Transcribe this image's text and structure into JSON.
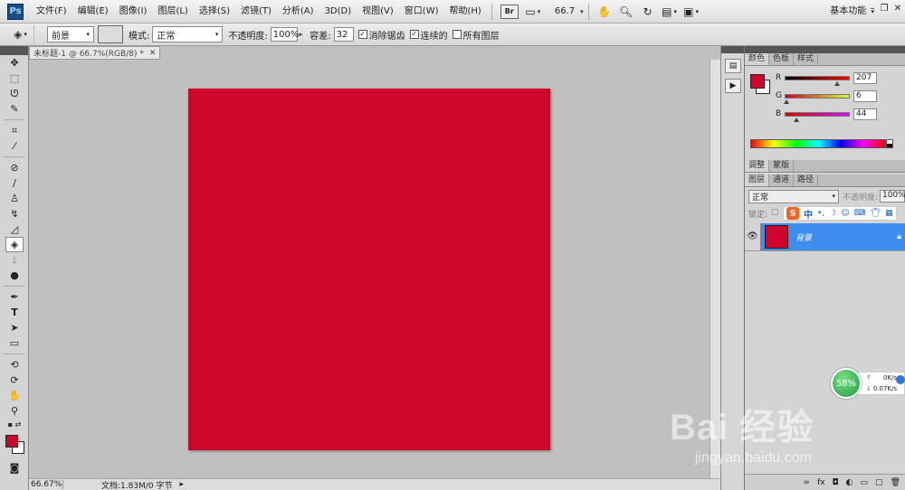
{
  "menubar": {
    "logo": "Ps",
    "items": [
      "文件(F)",
      "编辑(E)",
      "图像(I)",
      "图层(L)",
      "选择(S)",
      "滤镜(T)",
      "分析(A)",
      "3D(D)",
      "视图(V)",
      "窗口(W)",
      "帮助(H)"
    ],
    "bridge_label": "Br",
    "zoom_value": "66.7",
    "workspace": "基本功能"
  },
  "options_bar": {
    "fill_source": "前景",
    "mode_label": "模式:",
    "mode_value": "正常",
    "opacity_label": "不透明度:",
    "opacity_value": "100%",
    "tolerance_label": "容差:",
    "tolerance_value": "32",
    "antialias_label": "消除锯齿",
    "contiguous_label": "连续的",
    "all_layers_label": "所有图层"
  },
  "document": {
    "tab_title": "未标题-1 @ 66.7%(RGB/8) *",
    "canvas_color": "#cf062c",
    "status_zoom": "66.67%",
    "status_doc": "文档:1.83M/0 字节"
  },
  "color_panel": {
    "tabs": [
      "颜色",
      "色板",
      "样式"
    ],
    "r_label": "R",
    "r_value": "207",
    "g_label": "G",
    "g_value": "6",
    "b_label": "B",
    "b_value": "44",
    "r_fraction": 0.81,
    "g_fraction": 0.02,
    "b_fraction": 0.17
  },
  "adjust_panel": {
    "tabs": [
      "调整",
      "蒙版"
    ]
  },
  "layers_panel": {
    "tabs": [
      "图层",
      "通道",
      "路径"
    ],
    "blend_mode": "正常",
    "opacity_label": "不透明度:",
    "opacity_value": "100%",
    "lock_label": "锁定:",
    "layer_name": "背景"
  },
  "ime": {
    "lang": "中"
  },
  "net_widget": {
    "percent": "58%",
    "up_speed": "0K/s",
    "down_speed": "0.07K/s"
  },
  "watermark": {
    "logo": "Bai 经验",
    "url": "jingyan.baidu.com"
  }
}
